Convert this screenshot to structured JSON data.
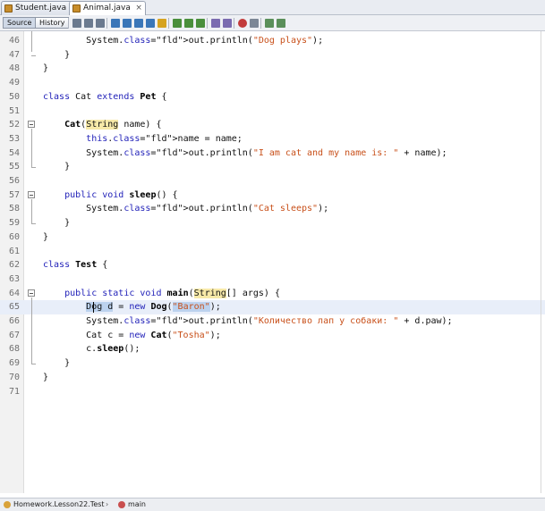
{
  "tabs": [
    {
      "label": "Student.java",
      "active": false
    },
    {
      "label": "Animal.java",
      "active": true
    }
  ],
  "toolbar": {
    "source_label": "Source",
    "history_label": "History",
    "icons": [
      "last-edit-icon",
      "back-icon",
      "forward-icon",
      "find-icon",
      "find-previous-icon",
      "find-next-icon",
      "find-selection-icon",
      "toggle-highlight-icon",
      "previous-bookmark-icon",
      "next-bookmark-icon",
      "toggle-bookmark-icon",
      "shift-left-icon",
      "shift-right-icon",
      "start-macro-icon",
      "stop-macro-icon",
      "comment-icon",
      "uncomment-icon"
    ]
  },
  "code_lines": [
    {
      "num": "46",
      "text": "        System.out.println(\"Dog plays\");"
    },
    {
      "num": "47",
      "text": "    }"
    },
    {
      "num": "48",
      "text": "}"
    },
    {
      "num": "49",
      "text": ""
    },
    {
      "num": "50",
      "text": "class Cat extends Pet {"
    },
    {
      "num": "51",
      "text": ""
    },
    {
      "num": "52",
      "text": "    Cat(String name) {"
    },
    {
      "num": "53",
      "text": "        this.name = name;"
    },
    {
      "num": "54",
      "text": "        System.out.println(\"I am cat and my name is: \" + name);"
    },
    {
      "num": "55",
      "text": "    }"
    },
    {
      "num": "56",
      "text": ""
    },
    {
      "num": "57",
      "text": "    public void sleep() {"
    },
    {
      "num": "58",
      "text": "        System.out.println(\"Cat sleeps\");"
    },
    {
      "num": "59",
      "text": "    }"
    },
    {
      "num": "60",
      "text": "}"
    },
    {
      "num": "61",
      "text": ""
    },
    {
      "num": "62",
      "text": "class Test {"
    },
    {
      "num": "63",
      "text": ""
    },
    {
      "num": "64",
      "text": "    public static void main(String[] args) {"
    },
    {
      "num": "65",
      "text": "        Dog d = new Dog(\"Baron\");"
    },
    {
      "num": "66",
      "text": "        System.out.println(\"Количество лап у собаки: \" + d.paw);"
    },
    {
      "num": "67",
      "text": "        Cat c = new Cat(\"Tosha\");"
    },
    {
      "num": "68",
      "text": "        c.sleep();"
    },
    {
      "num": "69",
      "text": "    }"
    },
    {
      "num": "70",
      "text": "}"
    },
    {
      "num": "71",
      "text": ""
    }
  ],
  "current_line": "65",
  "breadcrumb": {
    "class_path": "Homework.Lesson22.Test",
    "method": "main"
  },
  "colors": {
    "keyword": "#1f1fb8",
    "field": "#0a8a0a",
    "string": "#c8501a",
    "current_line_bg": "#e8eef9",
    "occurrence_highlight": "#f7e9a8",
    "selection": "#bcd2ee"
  }
}
